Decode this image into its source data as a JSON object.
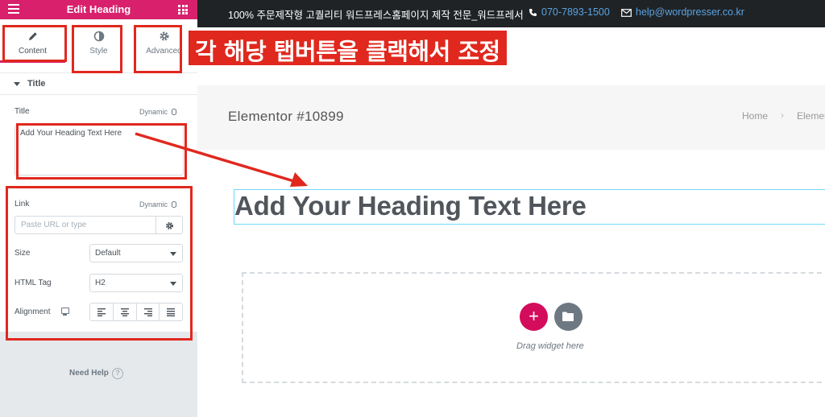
{
  "panel": {
    "header_title": "Edit Heading",
    "tabs": [
      {
        "label": "Content",
        "icon": "pencil-icon",
        "active": true
      },
      {
        "label": "Style",
        "icon": "half-circle-icon"
      },
      {
        "label": "Advanced",
        "icon": "gear-icon"
      }
    ],
    "section_title": "Title",
    "title_label": "Title",
    "dynamic_label": "Dynamic",
    "title_value": "Add Your Heading Text Here",
    "link_label": "Link",
    "link_placeholder": "Paste URL or type",
    "size_label": "Size",
    "size_value": "Default",
    "html_tag_label": "HTML Tag",
    "html_tag_value": "H2",
    "alignment_label": "Alignment",
    "alignment_options": [
      "left",
      "center",
      "right",
      "justify"
    ],
    "need_help": "Need Help",
    "help_icon_text": "?"
  },
  "preview": {
    "topbar_intro": "100% 주문제작형 고퀄리티 워드프레스홈페이지 제작 전문_워드프레서",
    "topbar_phone": "070-7893-1500",
    "topbar_email": "help@wordpresser.co.kr",
    "page_title": "Elementor #10899",
    "breadcrumb_home": "Home",
    "breadcrumb_sep": "›",
    "breadcrumb_next": "Elemen",
    "heading_text": "Add Your Heading Text Here",
    "add_symbol": "+",
    "drag_text": "Drag widget here"
  },
  "annotation": {
    "caption": "각 해당 탭버튼을 클랙해서 조정",
    "color": "#e0281e"
  },
  "colors": {
    "brand": "#d8206c",
    "panel_bg": "#e6e9ec",
    "topbar_bg": "#1f2326",
    "link_blue": "#5aa3e0"
  }
}
